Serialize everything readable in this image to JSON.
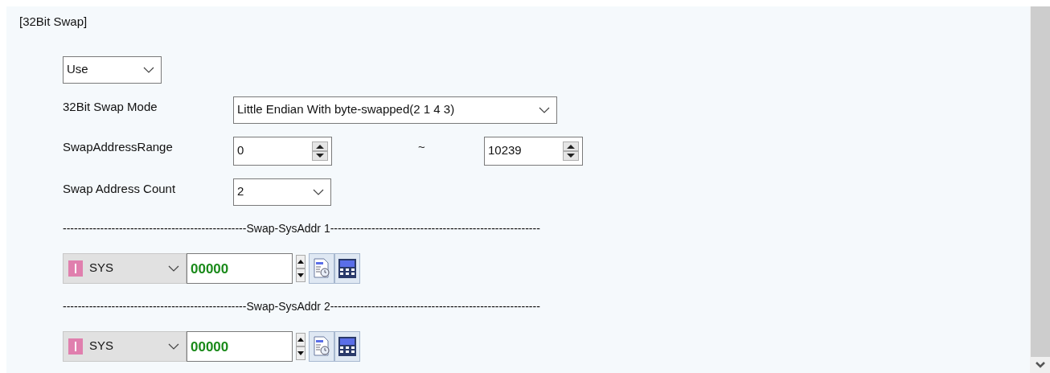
{
  "section_title": "[32Bit Swap]",
  "use_select": {
    "value": "Use"
  },
  "fields": [
    {
      "kind": "select",
      "label": "32Bit Swap Mode",
      "value": "Little Endian With byte-swapped(2 1 4 3)"
    },
    {
      "kind": "range",
      "label": "SwapAddressRange",
      "value": "0",
      "separator": "~",
      "value_2": "10239"
    },
    {
      "kind": "select",
      "label": "Swap Address Count",
      "value": "2"
    }
  ],
  "addresses": [
    {
      "separator": "-------------------------------------------------Swap-SysAddr 1--------------------------------------------------------",
      "device": "SYS",
      "value": "00000"
    },
    {
      "separator": "-------------------------------------------------Swap-SysAddr 2--------------------------------------------------------",
      "device": "SYS",
      "value": "00000"
    }
  ]
}
